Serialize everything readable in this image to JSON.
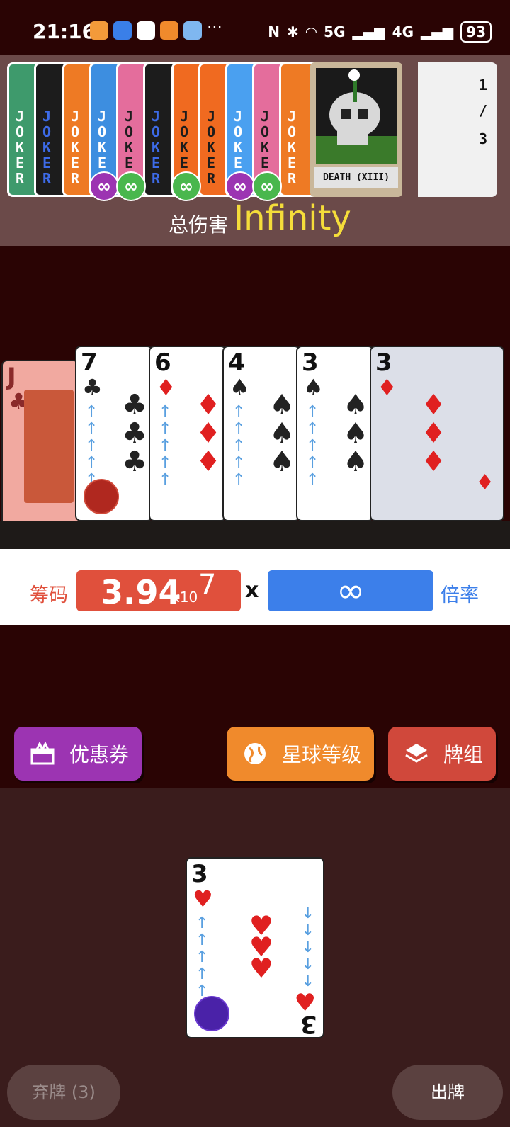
{
  "status_bar": {
    "time": "21:16",
    "battery": "93",
    "network_1": "5G",
    "network_2": "4G"
  },
  "jokers": {
    "card_text": [
      "J",
      "O",
      "K",
      "E",
      "R"
    ],
    "badge_symbol": "∞",
    "colors": {
      "green": "#3e9a6c",
      "black": "#1c1c1c",
      "orange": "#ee7a24",
      "blue": "#3d8ee0",
      "pink": "#e46d9c",
      "red_orange": "#f06a20",
      "light_blue": "#4aa0f0"
    },
    "badge_colors": {
      "purple": "#9c34b2",
      "green": "#49b74d"
    }
  },
  "tarot": {
    "label": "DEATH (XIII)"
  },
  "slots": {
    "used": "1",
    "separator": "/",
    "total": "3"
  },
  "total_damage": {
    "label": "总伤害",
    "value": "Infinity"
  },
  "played_cards": [
    {
      "rank": "J",
      "suit": "♣",
      "suit_name": "clubs"
    },
    {
      "rank": "7",
      "suit": "♣",
      "suit_name": "clubs"
    },
    {
      "rank": "6",
      "suit": "♦",
      "suit_name": "diamonds"
    },
    {
      "rank": "4",
      "suit": "♠",
      "suit_name": "spades"
    },
    {
      "rank": "3",
      "suit": "♠",
      "suit_name": "spades"
    },
    {
      "rank": "3",
      "suit": "♦",
      "suit_name": "diamonds"
    }
  ],
  "score": {
    "chips_label": "筹码",
    "chips_value": "3.94",
    "chips_x10": "x10",
    "chips_exponent": "7",
    "times": "x",
    "mult_value": "∞",
    "mult_label": "倍率"
  },
  "buttons": {
    "coupon": "优惠券",
    "planet": "星球等级",
    "deck": "牌组",
    "discard": "弃牌 (3)",
    "play": "出牌"
  },
  "hand_card": {
    "rank": "3",
    "suit": "♥",
    "rank_bottom": "3"
  }
}
